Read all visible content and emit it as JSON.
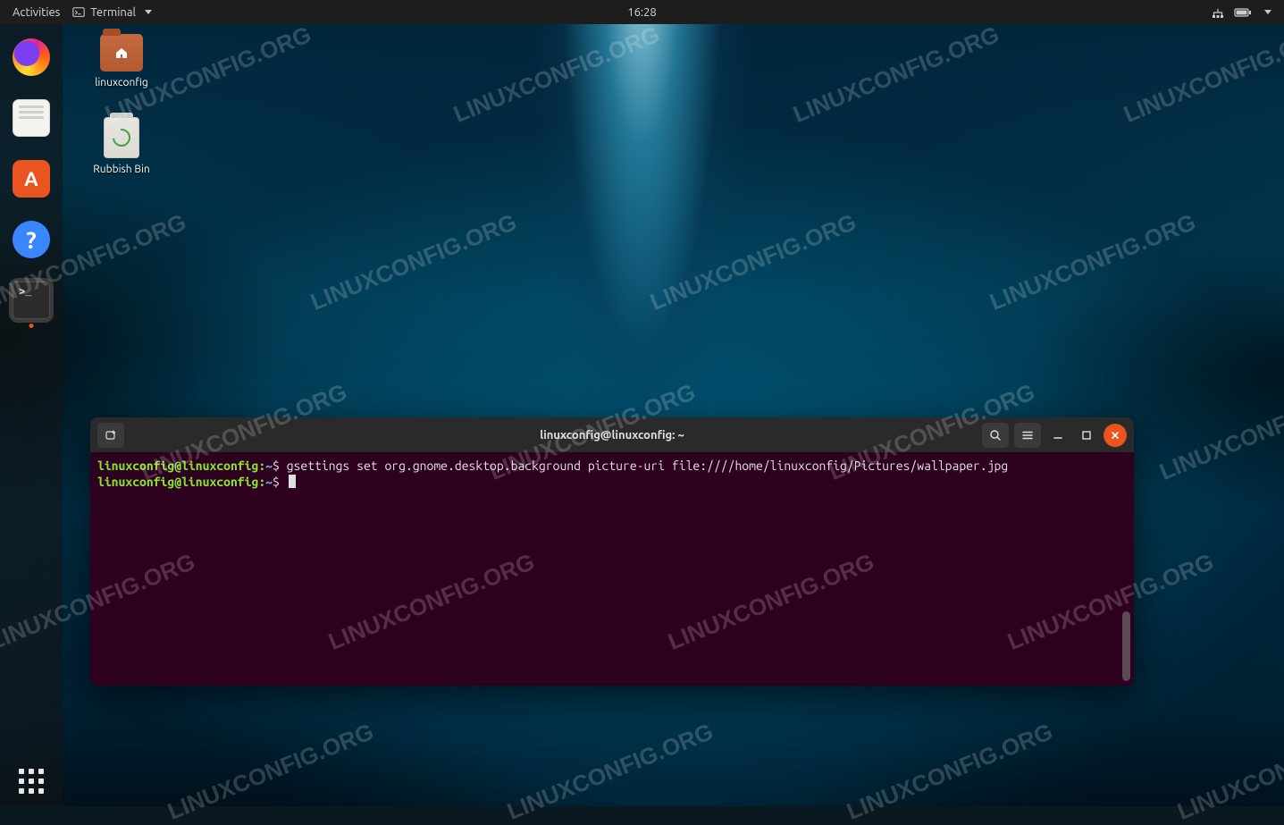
{
  "topbar": {
    "activities": "Activities",
    "app_name": "Terminal",
    "clock": "16:28"
  },
  "desktop": {
    "home_folder": "linuxconfig",
    "trash": "Rubbish Bin"
  },
  "dock": {
    "items": [
      {
        "name": "firefox",
        "active": false,
        "running": false
      },
      {
        "name": "files",
        "active": false,
        "running": false
      },
      {
        "name": "software",
        "active": false,
        "running": false
      },
      {
        "name": "help",
        "active": false,
        "running": false
      },
      {
        "name": "terminal",
        "active": true,
        "running": true
      }
    ]
  },
  "terminal": {
    "title": "linuxconfig@linuxconfig: ~",
    "lines": [
      {
        "user": "linuxconfig@linuxconfig",
        "path": "~",
        "prompt": "$",
        "command": "gsettings set org.gnome.desktop.background picture-uri file:////home/linuxconfig/Pictures/wallpaper.jpg"
      },
      {
        "user": "linuxconfig@linuxconfig",
        "path": "~",
        "prompt": "$",
        "command": ""
      }
    ]
  },
  "watermark": "LINUXCONFIG.ORG"
}
